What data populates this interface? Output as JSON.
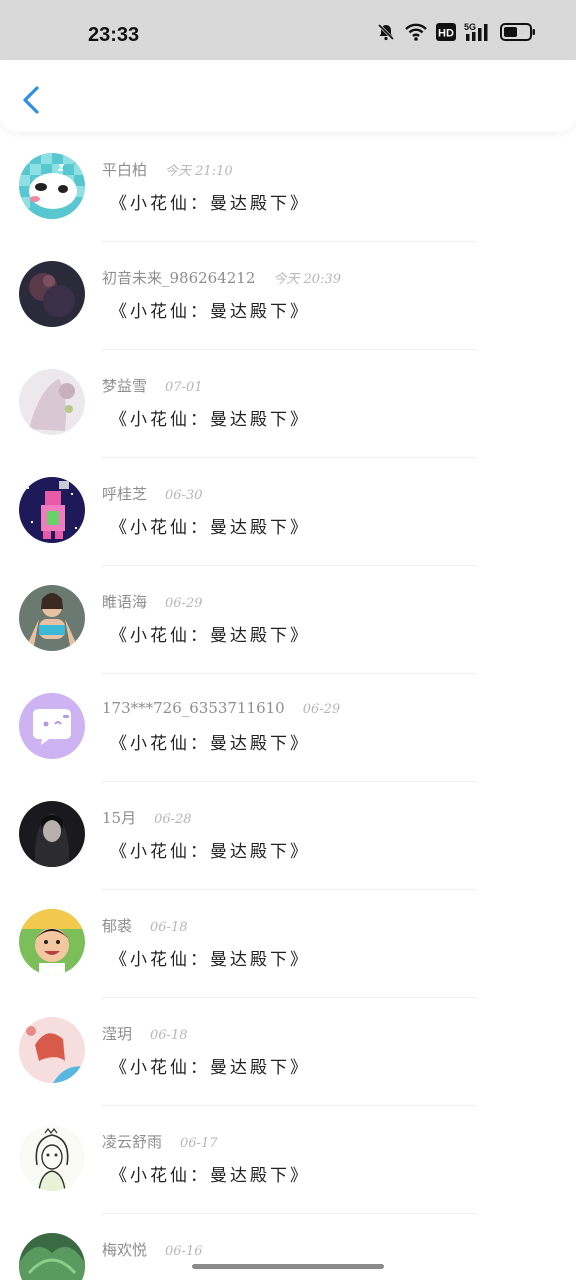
{
  "status_bar": {
    "time": "23:33",
    "icons": [
      "mute-bell-icon",
      "wifi-icon",
      "hd-icon",
      "5g-signal-icon",
      "battery-icon"
    ],
    "hd_label": "HD",
    "network_label": "5G"
  },
  "header": {
    "back_icon": "chevron-left-icon",
    "accent": "#2f8fe3"
  },
  "items": [
    {
      "name": "平白柏",
      "time": "今天 21:10",
      "title": "《小花仙：曼达殿下》"
    },
    {
      "name": "初音未来_986264212",
      "time": "今天 20:39",
      "title": "《小花仙：曼达殿下》"
    },
    {
      "name": "梦益雪",
      "time": "07-01",
      "title": "《小花仙：曼达殿下》"
    },
    {
      "name": "呼桂芝",
      "time": "06-30",
      "title": "《小花仙：曼达殿下》"
    },
    {
      "name": "睢语海",
      "time": "06-29",
      "title": "《小花仙：曼达殿下》"
    },
    {
      "name": "173***726_6353711610",
      "time": "06-29",
      "title": "《小花仙：曼达殿下》"
    },
    {
      "name": "15月",
      "time": "06-28",
      "title": "《小花仙：曼达殿下》"
    },
    {
      "name": "郁裘",
      "time": "06-18",
      "title": "《小花仙：曼达殿下》"
    },
    {
      "name": "滢玥",
      "time": "06-18",
      "title": "《小花仙：曼达殿下》"
    },
    {
      "name": "凌云舒雨",
      "time": "06-17",
      "title": "《小花仙：曼达殿下》"
    },
    {
      "name": "梅欢悦",
      "time": "06-16",
      "title": ""
    }
  ]
}
